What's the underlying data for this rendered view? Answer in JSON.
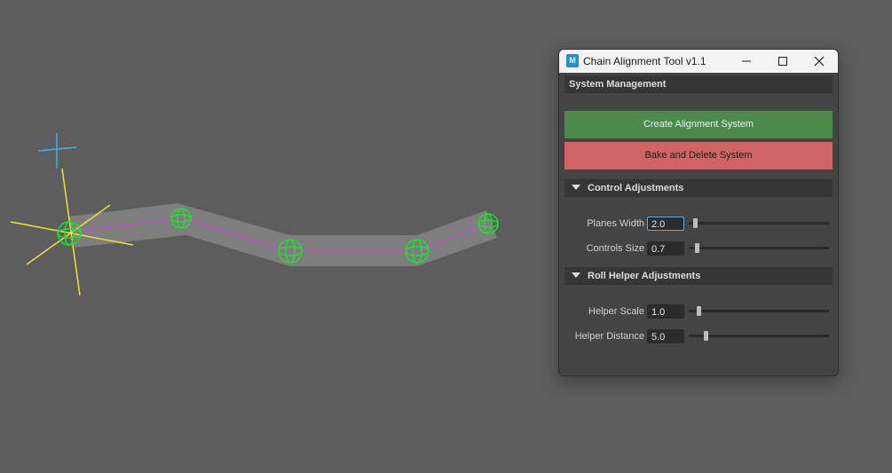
{
  "window": {
    "title": "Chain Alignment Tool v1.1",
    "app_icon_letter": "M"
  },
  "system_management": {
    "header": "System Management",
    "create_label": "Create Alignment System",
    "bake_label": "Bake and Delete System"
  },
  "control_adjustments": {
    "header": "Control Adjustments",
    "planes_width": {
      "label": "Planes Width",
      "value": "2.0"
    },
    "controls_size": {
      "label": "Controls Size",
      "value": "0.7"
    }
  },
  "roll_helper": {
    "header": "Roll Helper Adjustments",
    "helper_scale": {
      "label": "Helper Scale",
      "value": "1.0"
    },
    "helper_distance": {
      "label": "Helper Distance",
      "value": "5.0"
    }
  },
  "colors": {
    "viewport_bg": "#5d5d5d",
    "create_button": "#4c8a4c",
    "bake_button": "#d06464",
    "control_green": "#22dd33",
    "chain_line": "#c050c0",
    "axis_yellow": "#f0e040",
    "axis_blue": "#40b0f0"
  }
}
